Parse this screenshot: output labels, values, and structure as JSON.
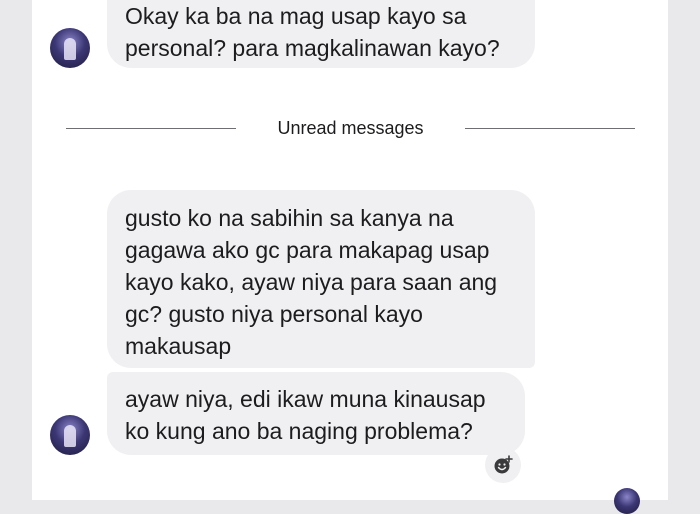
{
  "messages": [
    {
      "text": "Okay ka ba na mag usap kayo sa\npersonal? para magkalinawan kayo?"
    },
    {
      "text": "gusto ko na sabihin sa kanya na\ngagawa ako gc para makapag usap\nkayo kako, ayaw niya para saan ang\ngc? gusto niya personal kayo\nmakausap"
    },
    {
      "text": "ayaw niya, edi ikaw muna kinausap\nko kung ano ba naging problema?"
    }
  ],
  "divider": {
    "label": "Unread messages"
  },
  "icons": {
    "reaction": "add-reaction-icon"
  },
  "colors": {
    "bubble": "#f0f0f2",
    "text": "#1c1c1e",
    "background": "#ffffff"
  }
}
